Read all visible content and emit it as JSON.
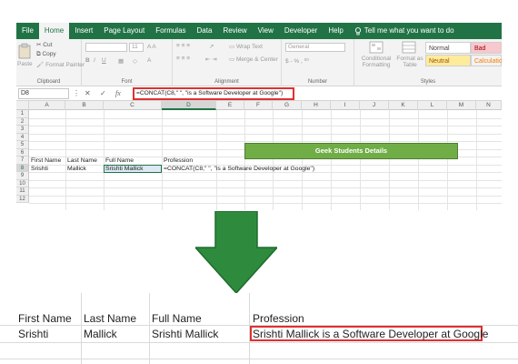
{
  "ribbon_tabs": [
    "File",
    "Home",
    "Insert",
    "Page Layout",
    "Formulas",
    "Data",
    "Review",
    "View",
    "Developer",
    "Help"
  ],
  "active_tab": "Home",
  "tell_me": "Tell me what you want to do",
  "clipboard": {
    "cut": "Cut",
    "copy": "Copy",
    "format_painter": "Format Painter",
    "paste": "Paste",
    "group": "Clipboard"
  },
  "font": {
    "size": "11",
    "group": "Font"
  },
  "alignment": {
    "wrap_text": "Wrap Text",
    "merge_center": "Merge & Center",
    "group": "Alignment"
  },
  "number": {
    "format": "General",
    "group": "Number"
  },
  "styles": {
    "conditional": "Conditional Formatting",
    "format_as_table": "Format as Table",
    "normal_1": "Normal",
    "bad": "Bad",
    "normal_2": "Neutral",
    "calculation": "Calculation",
    "group": "Styles"
  },
  "name_box": "D8",
  "fx": "fx",
  "formula": "=CONCAT(C8,\" \", \"is a Software Developer at Google\")",
  "columns": [
    "A",
    "B",
    "C",
    "D",
    "E",
    "F",
    "G",
    "H",
    "I",
    "J",
    "K",
    "L",
    "M",
    "N"
  ],
  "rows": [
    "1",
    "2",
    "3",
    "4",
    "5",
    "6",
    "7",
    "8",
    "9",
    "10",
    "11",
    "12"
  ],
  "sheet": {
    "title": "Geek Students Details",
    "headers": [
      "First Name",
      "Last Name",
      "Full Name",
      "Profession"
    ],
    "row8": [
      "Srishti",
      "Mallick",
      "Srishti Mallick",
      "=CONCAT(C8,\" \", \"is a Software Developer at Google\")"
    ]
  },
  "result": {
    "headers": [
      "First Name",
      "Last Name",
      "Full Name",
      "Profession"
    ],
    "row": [
      "Srishti",
      "Mallick",
      "Srishti Mallick",
      "Srishti Mallick is a Software Developer at Google"
    ]
  },
  "colors": {
    "excel_green": "#217346",
    "title_fill": "#70ad47",
    "arrow_fill": "#2e8b3e",
    "highlight": "#e03030"
  }
}
